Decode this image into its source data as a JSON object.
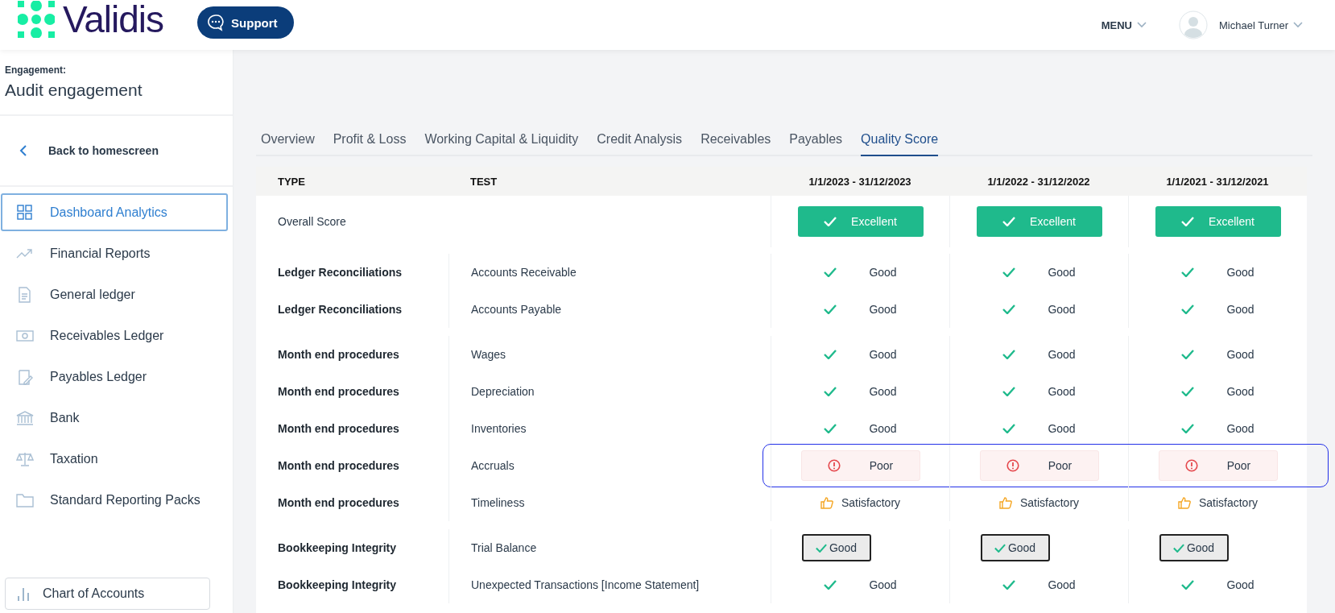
{
  "header": {
    "brand": "Validis",
    "support_button": "Support",
    "menu": "MENU",
    "user_name": "Michael Turner"
  },
  "sidebar": {
    "engagement_label": "Engagement:",
    "engagement_name": "Audit engagement",
    "back_link": "Back to homescreen",
    "items": [
      {
        "label": "Dashboard Analytics",
        "selected": true
      },
      {
        "label": "Financial Reports",
        "selected": false
      },
      {
        "label": "General ledger",
        "selected": false
      },
      {
        "label": "Receivables Ledger",
        "selected": false
      },
      {
        "label": "Payables Ledger",
        "selected": false
      },
      {
        "label": "Bank",
        "selected": false
      },
      {
        "label": "Taxation",
        "selected": false
      },
      {
        "label": "Standard Reporting Packs",
        "selected": false
      }
    ],
    "bottom_button": "Chart of Accounts"
  },
  "tabs": [
    {
      "label": "Overview",
      "selected": false
    },
    {
      "label": "Profit & Loss",
      "selected": false
    },
    {
      "label": "Working Capital & Liquidity",
      "selected": false
    },
    {
      "label": "Credit Analysis",
      "selected": false
    },
    {
      "label": "Receivables",
      "selected": false
    },
    {
      "label": "Payables",
      "selected": false
    },
    {
      "label": "Quality Score",
      "selected": true
    }
  ],
  "table": {
    "columns": [
      "TYPE",
      "TEST",
      "1/1/2023 - 31/12/2023",
      "1/1/2022 - 31/12/2022",
      "1/1/2021 - 31/12/2021"
    ],
    "overall": {
      "label": "Overall Score",
      "results": [
        {
          "kind": "badge",
          "label": "Excellent"
        },
        {
          "kind": "badge",
          "label": "Excellent"
        },
        {
          "kind": "badge",
          "label": "Excellent"
        }
      ]
    },
    "groups": [
      {
        "rows": [
          {
            "type": "Ledger Reconciliations",
            "test": "Accounts Receivable",
            "highlighted": false,
            "results": [
              {
                "kind": "check",
                "label": "Good"
              },
              {
                "kind": "check",
                "label": "Good"
              },
              {
                "kind": "check",
                "label": "Good"
              }
            ]
          },
          {
            "type": "Ledger Reconciliations",
            "test": "Accounts Payable",
            "highlighted": false,
            "results": [
              {
                "kind": "check",
                "label": "Good"
              },
              {
                "kind": "check",
                "label": "Good"
              },
              {
                "kind": "check",
                "label": "Good"
              }
            ]
          }
        ]
      },
      {
        "rows": [
          {
            "type": "Month end procedures",
            "test": "Wages",
            "highlighted": false,
            "results": [
              {
                "kind": "check",
                "label": "Good"
              },
              {
                "kind": "check",
                "label": "Good"
              },
              {
                "kind": "check",
                "label": "Good"
              }
            ]
          },
          {
            "type": "Month end procedures",
            "test": "Depreciation",
            "highlighted": false,
            "results": [
              {
                "kind": "check",
                "label": "Good"
              },
              {
                "kind": "check",
                "label": "Good"
              },
              {
                "kind": "check",
                "label": "Good"
              }
            ]
          },
          {
            "type": "Month end procedures",
            "test": "Inventories",
            "highlighted": false,
            "results": [
              {
                "kind": "check",
                "label": "Good"
              },
              {
                "kind": "check",
                "label": "Good"
              },
              {
                "kind": "check",
                "label": "Good"
              }
            ]
          },
          {
            "type": "Month end procedures",
            "test": "Accruals",
            "highlighted": true,
            "results": [
              {
                "kind": "alert",
                "label": "Poor"
              },
              {
                "kind": "alert",
                "label": "Poor"
              },
              {
                "kind": "alert",
                "label": "Poor"
              }
            ]
          },
          {
            "type": "Month end procedures",
            "test": "Timeliness",
            "highlighted": false,
            "results": [
              {
                "kind": "thumb",
                "label": "Satisfactory"
              },
              {
                "kind": "thumb",
                "label": "Satisfactory"
              },
              {
                "kind": "thumb",
                "label": "Satisfactory"
              }
            ]
          }
        ]
      },
      {
        "rows": [
          {
            "type": "Bookkeeping Integrity",
            "test": "Trial Balance",
            "highlighted": false,
            "results": [
              {
                "kind": "boxed",
                "label": "Good"
              },
              {
                "kind": "boxed",
                "label": "Good"
              },
              {
                "kind": "boxed",
                "label": "Good"
              }
            ]
          },
          {
            "type": "Bookkeeping Integrity",
            "test": "Unexpected Transactions [Income Statement]",
            "highlighted": false,
            "results": [
              {
                "kind": "check",
                "label": "Good"
              },
              {
                "kind": "check",
                "label": "Good"
              },
              {
                "kind": "check",
                "label": "Good"
              }
            ]
          }
        ]
      }
    ]
  }
}
